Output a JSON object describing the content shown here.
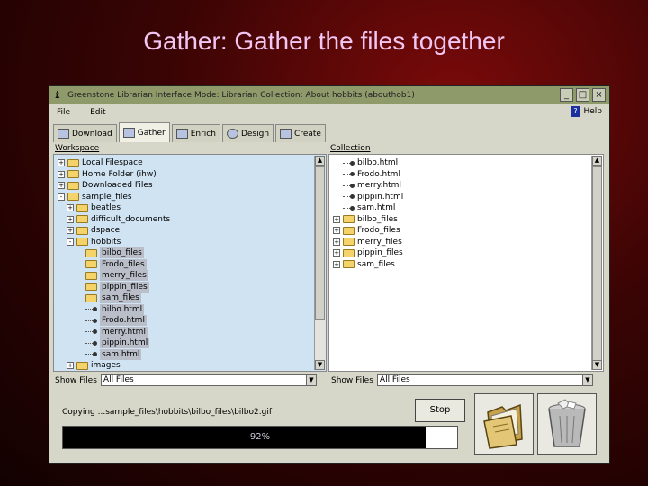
{
  "slide": {
    "title": "Gather: Gather the files together"
  },
  "window": {
    "title": "Greenstone Librarian Interface  Mode: Librarian  Collection: About hobbits (abouthob1)",
    "menu": {
      "file": "File",
      "edit": "Edit",
      "help": "Help"
    },
    "tabs": [
      {
        "label": "Download",
        "icon": "download-icon"
      },
      {
        "label": "Gather",
        "icon": "gather-icon"
      },
      {
        "label": "Enrich",
        "icon": "enrich-icon"
      },
      {
        "label": "Design",
        "icon": "design-icon"
      },
      {
        "label": "Create",
        "icon": "create-icon"
      }
    ],
    "active_tab": "Gather"
  },
  "workspace": {
    "label": "Workspace",
    "tree": [
      {
        "label": "Local Filespace",
        "type": "folder",
        "toggle": "+"
      },
      {
        "label": "Home Folder (ihw)",
        "type": "folder",
        "toggle": "+"
      },
      {
        "label": "Downloaded Files",
        "type": "folder",
        "toggle": "+"
      },
      {
        "label": "sample_files",
        "type": "folder",
        "toggle": "-"
      },
      {
        "label": "beatles",
        "type": "folder",
        "toggle": "+"
      },
      {
        "label": "difficult_documents",
        "type": "folder",
        "toggle": "+"
      },
      {
        "label": "dspace",
        "type": "folder",
        "toggle": "+"
      },
      {
        "label": "hobbits",
        "type": "folder",
        "toggle": "-"
      },
      {
        "label": "bilbo_files",
        "type": "folder",
        "selected": true
      },
      {
        "label": "Frodo_files",
        "type": "folder",
        "selected": true
      },
      {
        "label": "merry_files",
        "type": "folder",
        "selected": true
      },
      {
        "label": "pippin_files",
        "type": "folder",
        "selected": true
      },
      {
        "label": "sam_files",
        "type": "folder",
        "selected": true
      },
      {
        "label": "bilbo.html",
        "type": "file",
        "selected": true
      },
      {
        "label": "Frodo.html",
        "type": "file",
        "selected": true
      },
      {
        "label": "merry.html",
        "type": "file",
        "selected": true
      },
      {
        "label": "pippin.html",
        "type": "file",
        "selected": true
      },
      {
        "label": "sam.html",
        "type": "file",
        "selected": true
      },
      {
        "label": "images",
        "type": "folder",
        "toggle": "+"
      }
    ],
    "show_files_label": "Show Files",
    "show_files_value": "All Files"
  },
  "collection": {
    "label": "Collection",
    "tree": [
      {
        "label": "bilbo.html",
        "type": "file"
      },
      {
        "label": "Frodo.html",
        "type": "file"
      },
      {
        "label": "merry.html",
        "type": "file"
      },
      {
        "label": "pippin.html",
        "type": "file"
      },
      {
        "label": "sam.html",
        "type": "file"
      },
      {
        "label": "bilbo_files",
        "type": "folder",
        "toggle": "+"
      },
      {
        "label": "Frodo_files",
        "type": "folder",
        "toggle": "+"
      },
      {
        "label": "merry_files",
        "type": "folder",
        "toggle": "+"
      },
      {
        "label": "pippin_files",
        "type": "folder",
        "toggle": "+"
      },
      {
        "label": "sam_files",
        "type": "folder",
        "toggle": "+"
      }
    ],
    "show_files_label": "Show Files",
    "show_files_value": "All Files"
  },
  "status": {
    "message": "Copying ...sample_files\\hobbits\\bilbo_files\\bilbo2.gif",
    "stop_label": "Stop",
    "progress_percent": 92,
    "progress_text": "92%"
  },
  "actions": {
    "folder_icon": "new-folder-icon",
    "trash_icon": "trash-can-icon"
  },
  "colors": {
    "workspace_bg": "#cfe3f3",
    "titlebar": "#8f9a6b",
    "slide_title": "#f2c6f2"
  }
}
